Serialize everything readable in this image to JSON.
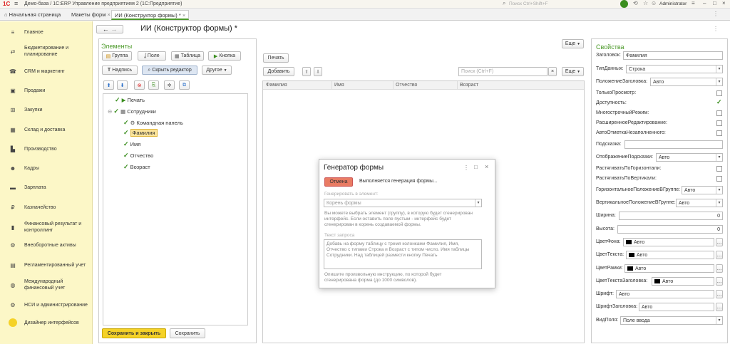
{
  "app_title": "Демо-база / 1С:ERP Управление предприятием 2  (1С:Предприятие)",
  "search_placeholder": "Поиск Ctrl+Shift+F",
  "user": "Administrator",
  "tabs": [
    {
      "label": "Начальная страница"
    },
    {
      "label": "Макеты форм"
    },
    {
      "label": "ИИ (Конструктор формы) *"
    }
  ],
  "sidebar": [
    {
      "label": "Главное",
      "icon": "menu-icon",
      "glyph": "≡"
    },
    {
      "label": "Бюджетирование и планирование",
      "icon": "budget-icon",
      "glyph": "⇄"
    },
    {
      "label": "CRM и маркетинг",
      "icon": "crm-icon",
      "glyph": "☎"
    },
    {
      "label": "Продажи",
      "icon": "sales-icon",
      "glyph": "▣"
    },
    {
      "label": "Закупки",
      "icon": "cart-icon",
      "glyph": "⊞"
    },
    {
      "label": "Склад и доставка",
      "icon": "warehouse-icon",
      "glyph": "▦"
    },
    {
      "label": "Производство",
      "icon": "factory-icon",
      "glyph": "▙"
    },
    {
      "label": "Кадры",
      "icon": "staff-icon",
      "glyph": "☻"
    },
    {
      "label": "Зарплата",
      "icon": "salary-icon",
      "glyph": "▬"
    },
    {
      "label": "Казначейство",
      "icon": "treasury-icon",
      "glyph": "₽"
    },
    {
      "label": "Финансовый результат и контроллинг",
      "icon": "finance-icon",
      "glyph": "▮"
    },
    {
      "label": "Внеоборотные активы",
      "icon": "assets-icon",
      "glyph": "⚙"
    },
    {
      "label": "Регламентированный учет",
      "icon": "accounting-icon",
      "glyph": "▤"
    },
    {
      "label": "Международный финансовый учет",
      "icon": "intl-icon",
      "glyph": "◍"
    },
    {
      "label": "НСИ и администрирование",
      "icon": "admin-icon",
      "glyph": "⚙"
    },
    {
      "label": "Дизайнер интерфейсов",
      "icon": "designer-icon",
      "glyph": "●"
    }
  ],
  "form": {
    "title": "ИИ (Конструктор формы) *",
    "more_label": "Еще",
    "elements_title": "Элементы",
    "btn_group": "Группа",
    "btn_field": "Поле",
    "btn_table": "Таблица",
    "btn_button": "Кнопка",
    "btn_label": "Надпись",
    "btn_hide_editor": "Скрыть редактор",
    "btn_other": "Другое",
    "tree": [
      {
        "label": "Печать"
      },
      {
        "label": "Сотрудники"
      },
      {
        "label": "Командная панель"
      },
      {
        "label": "Фамилия"
      },
      {
        "label": "Имя"
      },
      {
        "label": "Отчество"
      },
      {
        "label": "Возраст"
      }
    ],
    "save_close": "Сохранить и закрыть",
    "save": "Сохранить"
  },
  "preview": {
    "print_btn": "Печать",
    "add_btn": "Добавить",
    "search_placeholder": "Поиск (Ctrl+F)",
    "clear": "×",
    "more_label": "Еще",
    "columns": [
      "Фамилия",
      "Имя",
      "Отчество",
      "Возраст"
    ]
  },
  "dialog": {
    "title": "Генератор формы",
    "cancel": "Отмена",
    "status": "Выполняется генерация формы...",
    "gen_label": "Генерировать в элемент:",
    "gen_value": "Корень формы",
    "hint1": "Вы можете выбрать элемент (группу), в которую будет сгенерирован интерфейс. Если оставить поле пустым - интерфейс будет сгенерирован в корень создаваемой формы.",
    "query_label": "Текст запроса",
    "query_text": "Добавь на форму таблицу с тремя колонками Фамилия, Имя, Отчество с типами Строка и Возраст с типом число. Имя таблицы Сотрудники. Над таблицей размести кнопку Печать",
    "hint2": "Опишите произвольную инструкцию, по которой будет сгенерирована форма (до 1000 символов)."
  },
  "props": {
    "title": "Свойства",
    "rows": [
      {
        "label": "Заголовок:",
        "kind": "text",
        "value": "Фамилия"
      },
      {
        "label": "ТипДанных:",
        "kind": "select",
        "value": "Строка"
      },
      {
        "label": "ПоложениеЗаголовка:",
        "kind": "select",
        "value": "Авто"
      },
      {
        "label": "ТолькоПросмотр:",
        "kind": "check",
        "checked": false
      },
      {
        "label": "Доступность:",
        "kind": "check",
        "checked": true
      },
      {
        "label": "МногострочныйРежим:",
        "kind": "check",
        "checked": false
      },
      {
        "label": "РасширенноеРедактирование:",
        "kind": "check",
        "checked": false
      },
      {
        "label": "АвтоОтметкаНезаполненного:",
        "kind": "check",
        "checked": false
      },
      {
        "label": "Подсказка:",
        "kind": "text",
        "value": ""
      },
      {
        "label": "ОтображениеПодсказки:",
        "kind": "select",
        "value": "Авто"
      },
      {
        "label": "РастягиватьПоГоризонтали:",
        "kind": "check",
        "checked": false
      },
      {
        "label": "РастягиватьПоВертикали:",
        "kind": "check",
        "checked": false
      },
      {
        "label": "ГоризонтальноеПоложениеВГруппе:",
        "kind": "select",
        "value": "Авто"
      },
      {
        "label": "ВертикальноеПоложениеВГруппе:",
        "kind": "select",
        "value": "Авто"
      },
      {
        "label": "Ширина:",
        "kind": "number",
        "value": "0"
      },
      {
        "label": "Высота:",
        "kind": "number",
        "value": "0"
      },
      {
        "label": "ЦветФона:",
        "kind": "color",
        "value": "Авто"
      },
      {
        "label": "ЦветТекста:",
        "kind": "color",
        "value": "Авто"
      },
      {
        "label": "ЦветРамки:",
        "kind": "color",
        "value": "Авто"
      },
      {
        "label": "ЦветТекстаЗаголовка:",
        "kind": "color",
        "value": "Авто"
      },
      {
        "label": "Шрифт:",
        "kind": "pick",
        "value": "Авто"
      },
      {
        "label": "ШрифтЗаголовка:",
        "kind": "pick",
        "value": "Авто"
      },
      {
        "label": "ВидПоля:",
        "kind": "select",
        "value": "Поле ввода"
      }
    ]
  },
  "colors": {
    "accent": "#4c9a2a",
    "sidebar_bg": "#fcf7c7",
    "primary_btn": "#f5d228",
    "cancel_btn": "#e97b63"
  }
}
